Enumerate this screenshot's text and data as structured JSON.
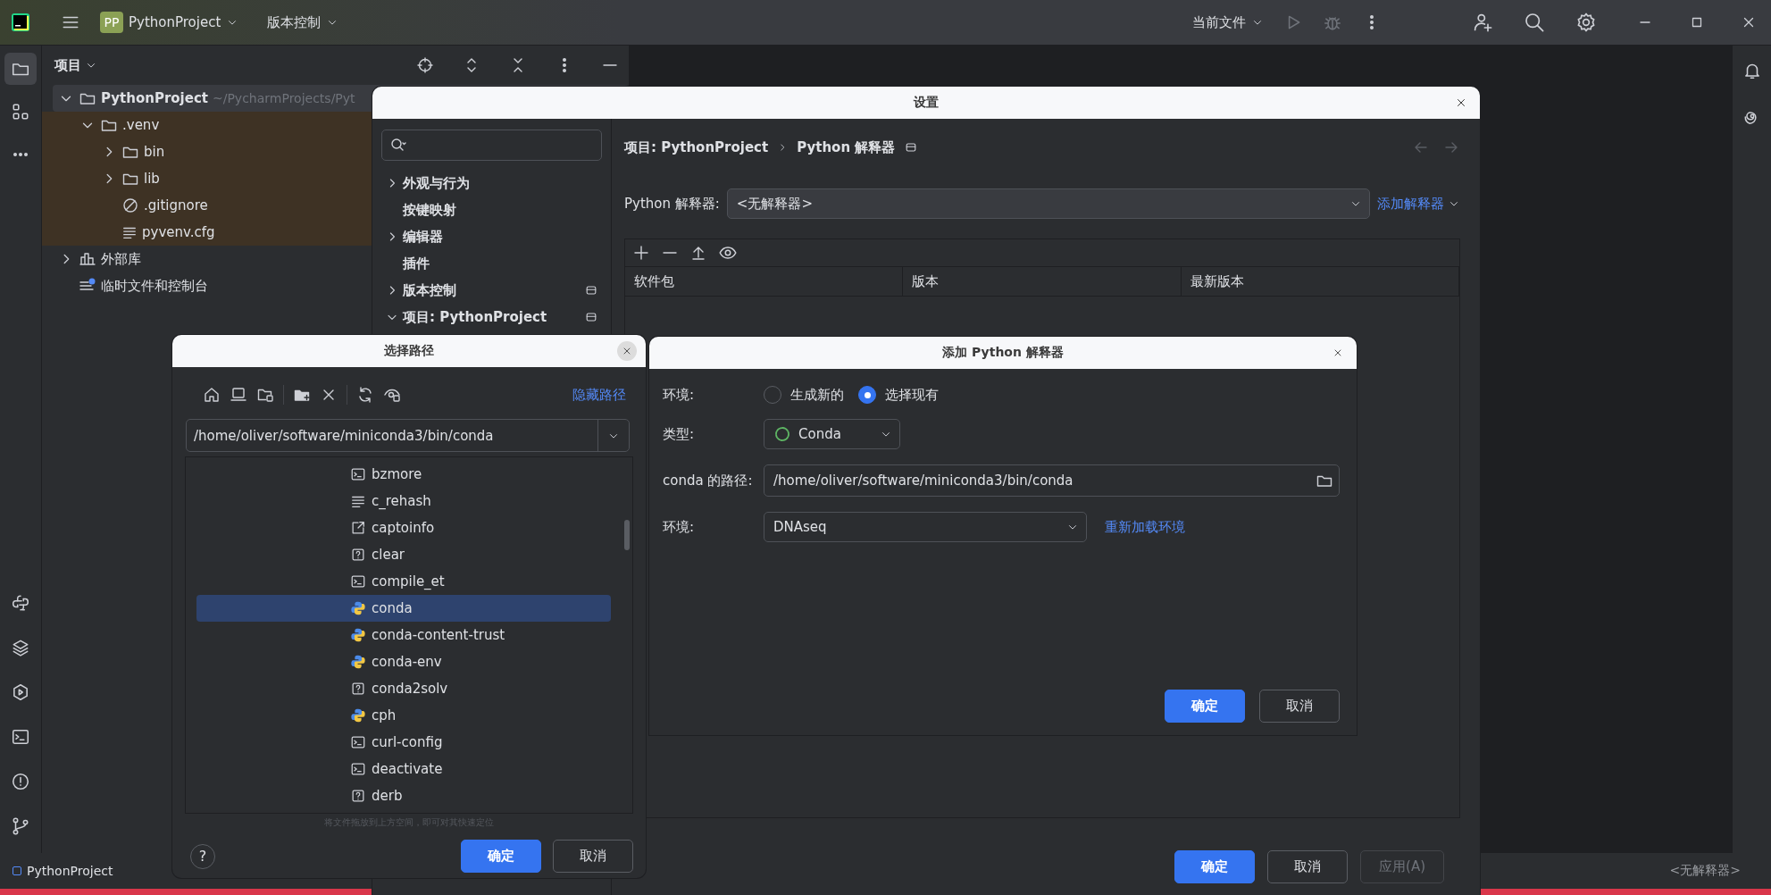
{
  "title_bar": {
    "project_badge": "PP",
    "project": "PythonProject",
    "vcs": "版本控制",
    "run_config": "当前文件"
  },
  "tool_buttons": [
    {
      "kind": "folder",
      "selected": true
    },
    {
      "kind": "structure",
      "selected": false
    },
    {
      "kind": "more",
      "selected": false
    }
  ],
  "bottom_tool_buttons": [
    {
      "kind": "python"
    },
    {
      "kind": "layers"
    },
    {
      "kind": "services"
    },
    {
      "kind": "terminal"
    },
    {
      "kind": "problems"
    },
    {
      "kind": "git"
    }
  ],
  "project_panel": {
    "title": "项目",
    "tree": [
      {
        "label": "PythonProject",
        "hint": "~/PycharmProjects/Pyt",
        "kind": "folder",
        "bold": true,
        "selected": true,
        "excluded": false,
        "expanded": true,
        "children": [
          {
            "label": ".venv",
            "kind": "folder-excluded",
            "selected": false,
            "excluded": true,
            "expanded": true,
            "children": [
              {
                "label": "bin",
                "kind": "folder-excluded",
                "selected": false,
                "excluded": true,
                "expanded": false
              },
              {
                "label": "lib",
                "kind": "folder-excluded",
                "selected": false,
                "excluded": true,
                "expanded": false
              },
              {
                "label": ".gitignore",
                "kind": "ignore",
                "selected": false,
                "excluded": true
              },
              {
                "label": "pyvenv.cfg",
                "kind": "text",
                "selected": false,
                "excluded": true
              }
            ]
          }
        ]
      },
      {
        "label": "外部库",
        "kind": "library",
        "selected": false,
        "excluded": false,
        "expanded": false
      },
      {
        "label": "临时文件和控制台",
        "kind": "scratch",
        "selected": false,
        "excluded": false
      }
    ]
  },
  "settings": {
    "title": "设置",
    "nav": [
      {
        "label": "外观与行为",
        "kind": "group",
        "expanded": false,
        "shared": false
      },
      {
        "label": "按键映射",
        "kind": "page",
        "shared": false
      },
      {
        "label": "编辑器",
        "kind": "group",
        "expanded": false,
        "shared": false
      },
      {
        "label": "插件",
        "kind": "page",
        "shared": false
      },
      {
        "label": "版本控制",
        "kind": "group",
        "expanded": false,
        "shared": true
      },
      {
        "label": "项目: PythonProject",
        "kind": "group",
        "expanded": true,
        "shared": true
      }
    ],
    "breadcrumb": [
      "项目: PythonProject",
      "Python 解释器"
    ],
    "interpreter_label": "Python 解释器:",
    "interpreter_value": "<无解释器>",
    "add_interpreter": "添加解释器",
    "columns": [
      "软件包",
      "版本",
      "最新版本"
    ],
    "buttons": [
      {
        "label": "确定",
        "kind": "primary"
      },
      {
        "label": "取消",
        "kind": "normal"
      },
      {
        "label": "应用(A)",
        "kind": "disabled"
      }
    ]
  },
  "choose_path": {
    "title": "选择路径",
    "hide_path": "隐藏路径",
    "path": "/home/oliver/software/miniconda3/bin/conda",
    "files": [
      {
        "name": "bzmore",
        "kind": "script",
        "selected": false
      },
      {
        "name": "c_rehash",
        "kind": "text",
        "selected": false
      },
      {
        "name": "captoinfo",
        "kind": "link",
        "selected": false
      },
      {
        "name": "clear",
        "kind": "unknown",
        "selected": false
      },
      {
        "name": "compile_et",
        "kind": "script",
        "selected": false
      },
      {
        "name": "conda",
        "kind": "python",
        "selected": true
      },
      {
        "name": "conda-content-trust",
        "kind": "python",
        "selected": false
      },
      {
        "name": "conda-env",
        "kind": "python",
        "selected": false
      },
      {
        "name": "conda2solv",
        "kind": "unknown",
        "selected": false
      },
      {
        "name": "cph",
        "kind": "python",
        "selected": false
      },
      {
        "name": "curl-config",
        "kind": "script",
        "selected": false
      },
      {
        "name": "deactivate",
        "kind": "script",
        "selected": false
      },
      {
        "name": "derb",
        "kind": "unknown",
        "selected": false
      }
    ],
    "hint": "将文件拖放到上方空间，即可对其快速定位",
    "help": "?",
    "buttons": [
      {
        "label": "确定",
        "kind": "primary"
      },
      {
        "label": "取消",
        "kind": "normal"
      }
    ]
  },
  "add_interpreter": {
    "title": "添加 Python 解释器",
    "env_label": "环境:",
    "env_options": [
      {
        "label": "生成新的",
        "selected": false
      },
      {
        "label": "选择现有",
        "selected": true
      }
    ],
    "type_label": "类型:",
    "type_value": "Conda",
    "path_label": "conda 的路径:",
    "path_value": "/home/oliver/software/miniconda3/bin/conda",
    "env2_label": "环境:",
    "env_value": "DNAseq",
    "reload": "重新加载环境",
    "buttons": [
      {
        "label": "确定",
        "kind": "primary"
      },
      {
        "label": "取消",
        "kind": "normal"
      }
    ]
  },
  "status_bar": {
    "project": "PythonProject",
    "interpreter": "<无解释器>"
  }
}
